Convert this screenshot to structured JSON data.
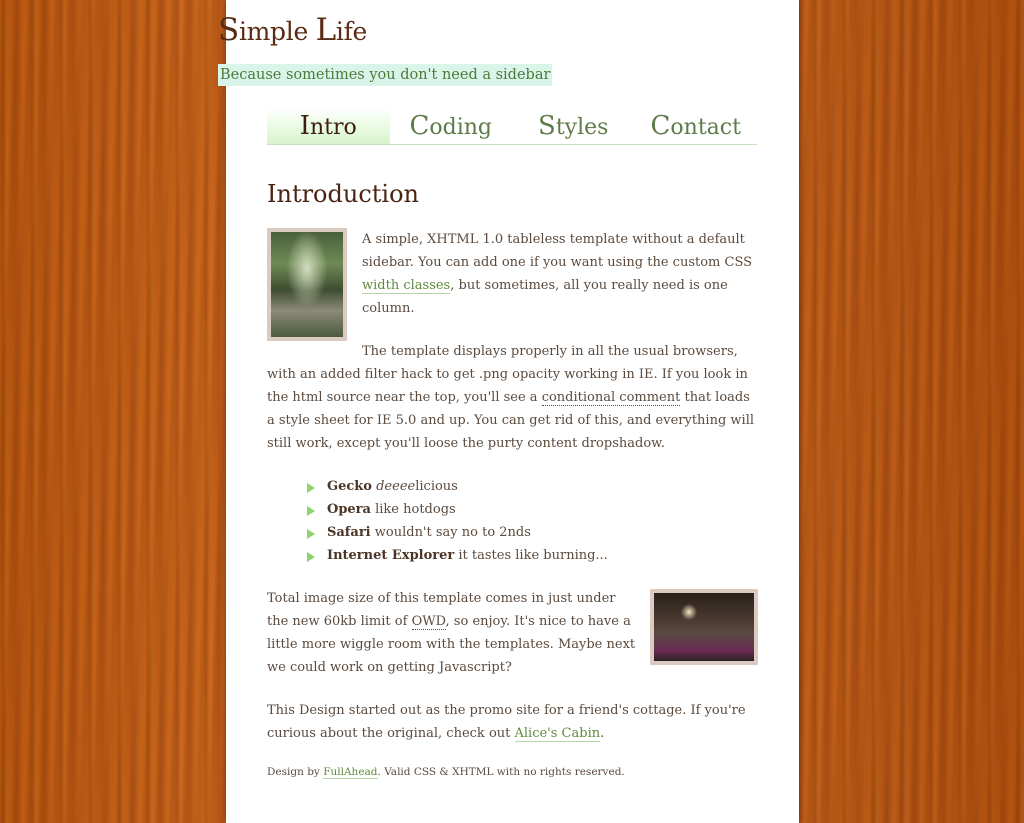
{
  "header": {
    "title_cap1": "S",
    "title_rest1": "imple ",
    "title_cap2": "L",
    "title_rest2": "ife",
    "tagline": "Because sometimes you don't need a sidebar"
  },
  "nav": {
    "tabs": [
      {
        "cap": "I",
        "rest": "ntro",
        "active": true
      },
      {
        "cap": "C",
        "rest": "oding",
        "active": false
      },
      {
        "cap": "S",
        "rest": "tyles",
        "active": false
      },
      {
        "cap": "C",
        "rest": "ontact",
        "active": false
      }
    ]
  },
  "main": {
    "heading": "Introduction",
    "p1_a": "A simple, XHTML 1.0 tableless template without a default sidebar. You can add one if you want using the custom CSS ",
    "p1_link": "width classes",
    "p1_b": ", but sometimes, all you really need is one column.",
    "p2_a": "The template displays properly in all the usual browsers, with an added filter hack to get .png opacity working in IE. If you look in the html source near the top, you'll see a ",
    "p2_link": "conditional comment",
    "p2_b": " that loads a style sheet for IE 5.0 and up. You can get rid of this, and everything will still work, except you'll loose the purty content dropshadow.",
    "browsers": [
      {
        "name": "Gecko",
        "italic": "deeee",
        "rest": "licious"
      },
      {
        "name": "Opera",
        "italic": "",
        "rest": " like hotdogs"
      },
      {
        "name": "Safari",
        "italic": "",
        "rest": " wouldn't say no to 2nds"
      },
      {
        "name": "Internet Explorer",
        "italic": "",
        "rest": " it tastes like burning..."
      }
    ],
    "p3_a": "Total image size of this template comes in just under the new 60kb limit of ",
    "p3_abbr": "OWD",
    "p3_b": ", so enjoy. It's nice to have a little more wiggle room with the templates. Maybe next we could work on getting Javascript?",
    "p4_a": "This Design started out as the promo site for a friend's cottage. If you're curious about the original, check out ",
    "p4_link": "Alice's Cabin",
    "p4_b": "."
  },
  "footer": {
    "prefix": "Design by ",
    "link": "FullAhead",
    "suffix": ". Valid CSS & XHTML with no rights reserved."
  },
  "colors": {
    "title": "#5a2a12",
    "tagline_bg": "#d9f5ea",
    "link": "#5f8b3b",
    "bullet": "#8fd36c",
    "wood": "#b8560f"
  },
  "icons": {
    "bullet": "green-triangle-bullet-icon"
  }
}
